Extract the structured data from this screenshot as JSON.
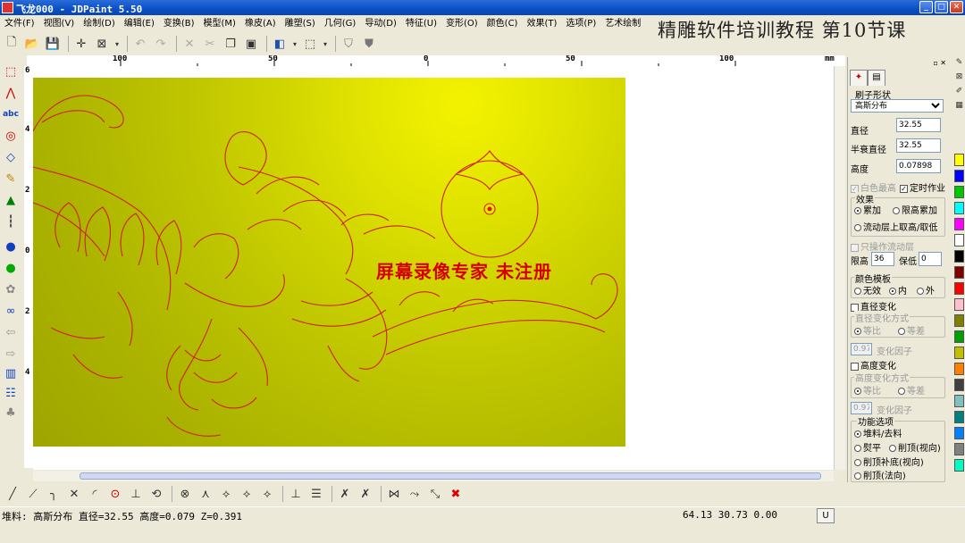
{
  "window": {
    "title": "飞龙000 - JDPaint 5.50"
  },
  "lesson_title": "精雕软件培训教程  第10节课",
  "menu": [
    "文件(F)",
    "视图(V)",
    "绘制(D)",
    "编辑(E)",
    "变换(B)",
    "模型(M)",
    "橡皮(A)",
    "雕塑(S)",
    "几何(G)",
    "导动(D)",
    "特征(U)",
    "变形(O)",
    "颜色(C)",
    "效果(T)",
    "选项(P)",
    "艺术绘制"
  ],
  "ruler": {
    "unit": "mm",
    "h_labels": [
      "100",
      "50",
      "0",
      "50",
      "100"
    ],
    "v_labels": [
      "6",
      "4",
      "2",
      "0",
      "2",
      "4"
    ]
  },
  "canvas": {
    "watermark": "屏幕录像专家  未注册"
  },
  "panel": {
    "brush_shape_label": "刷子形状",
    "brush_shape_value": "高斯分布",
    "diameter_label": "直径",
    "diameter_value": "32.55",
    "half_decay_label": "半衰直径",
    "half_decay_value": "32.55",
    "height_label": "高度",
    "height_value": "0.07898",
    "white_highest_label": "白色最高",
    "timed_work_label": "定时作业",
    "effect_label": "效果",
    "effect_add": "累加",
    "effect_limit": "限高累加",
    "effect_flow": "流动层上取高/取低",
    "only_flow_label": "只操作流动层",
    "limit_high_label": "限高",
    "limit_high_value": "36",
    "keep_low_label": "保低",
    "keep_low_value": "0",
    "color_template_label": "颜色模板",
    "color_none": "无效",
    "color_inside": "内",
    "color_outside": "外",
    "diameter_change_label": "直径变化",
    "diameter_change_mode_label": "直径变化方式",
    "mode_ratio": "等比",
    "mode_diff": "等差",
    "diameter_factor_value": "0.97",
    "change_factor_label": "变化因子",
    "height_change_label": "高度变化",
    "height_change_mode_label": "高度变化方式",
    "height_factor_value": "0.97",
    "function_label": "功能选项",
    "func_pile": "堆料/去料",
    "func_flatten": "熨平",
    "func_cut_top_view": "削顶(视向)",
    "func_cut_fill": "削顶补底(视向)",
    "func_cut_normal": "削顶(法向)"
  },
  "status": {
    "left": "堆料: 高斯分布  直径=32.55  高度=0.079  Z=0.391",
    "coords": "64.13 30.73 0.00",
    "indicator": "U"
  },
  "palette": [
    "#ffffff",
    "#ffff00",
    "#c8c8c8",
    "#e00000",
    "#ffff00",
    "#0000ff",
    "#00c800",
    "#00ffff",
    "#ff00ff",
    "#ffffff",
    "#000000",
    "#800000",
    "#ff0000",
    "#ffc0cb",
    "#808000",
    "#00a000",
    "#c0c000",
    "#ff8000",
    "#404040",
    "#80c0c0",
    "#008080",
    "#0080ff",
    "#808080",
    "#00ffc0"
  ]
}
